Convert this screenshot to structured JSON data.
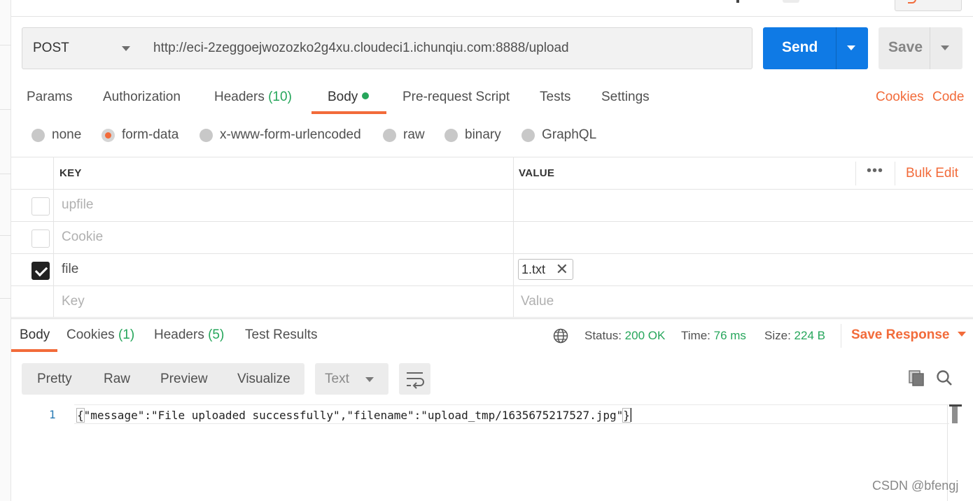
{
  "request": {
    "method": "POST",
    "url": "http://eci-2zeggoejwozozko2g4xu.cloudeci1.ichunqiu.com:8888/upload",
    "send_label": "Send",
    "save_label": "Save"
  },
  "request_tabs": [
    {
      "label": "Params",
      "count": ""
    },
    {
      "label": "Authorization",
      "count": ""
    },
    {
      "label": "Headers",
      "count": "(10)"
    },
    {
      "label": "Body",
      "count": ""
    },
    {
      "label": "Pre-request Script",
      "count": ""
    },
    {
      "label": "Tests",
      "count": ""
    },
    {
      "label": "Settings",
      "count": ""
    }
  ],
  "active_request_tab": "Body",
  "links": {
    "cookies": "Cookies",
    "code": "Code"
  },
  "body_types": [
    "none",
    "form-data",
    "x-www-form-urlencoded",
    "raw",
    "binary",
    "GraphQL"
  ],
  "selected_body_type": "form-data",
  "params_table": {
    "key_header": "KEY",
    "value_header": "VALUE",
    "bulk_edit": "Bulk Edit",
    "more": "•••",
    "rows": [
      {
        "checked": false,
        "key": "upfile",
        "value": ""
      },
      {
        "checked": false,
        "key": "Cookie",
        "value": ""
      },
      {
        "checked": true,
        "key": "file",
        "value": "1.txt"
      }
    ],
    "placeholder_key": "Key",
    "placeholder_value": "Value"
  },
  "response_tabs": [
    {
      "label": "Body",
      "count": ""
    },
    {
      "label": "Cookies",
      "count": "(1)"
    },
    {
      "label": "Headers",
      "count": "(5)"
    },
    {
      "label": "Test Results",
      "count": ""
    }
  ],
  "active_response_tab": "Body",
  "status": {
    "status_label": "Status:",
    "status_value": "200 OK",
    "time_label": "Time:",
    "time_value": "76 ms",
    "size_label": "Size:",
    "size_value": "224 B"
  },
  "save_response": "Save Response",
  "view_modes": [
    "Pretty",
    "Raw",
    "Preview",
    "Visualize"
  ],
  "format": "Text",
  "response_body": {
    "line_number": "1",
    "open_brace": "{",
    "text": "\"message\":\"File uploaded successfully\",\"filename\":\"upload_tmp/1635675217527.jpg\"",
    "close_brace": "}"
  },
  "watermark": "CSDN @bfengj",
  "colors": {
    "accent": "#f26b3a",
    "send": "#0f7ae5",
    "success": "#26a65b"
  },
  "icons": [
    "chevron-down-icon",
    "globe-icon",
    "copy-icon",
    "search-icon",
    "wrap-lines-icon",
    "close-icon",
    "more-icon"
  ]
}
